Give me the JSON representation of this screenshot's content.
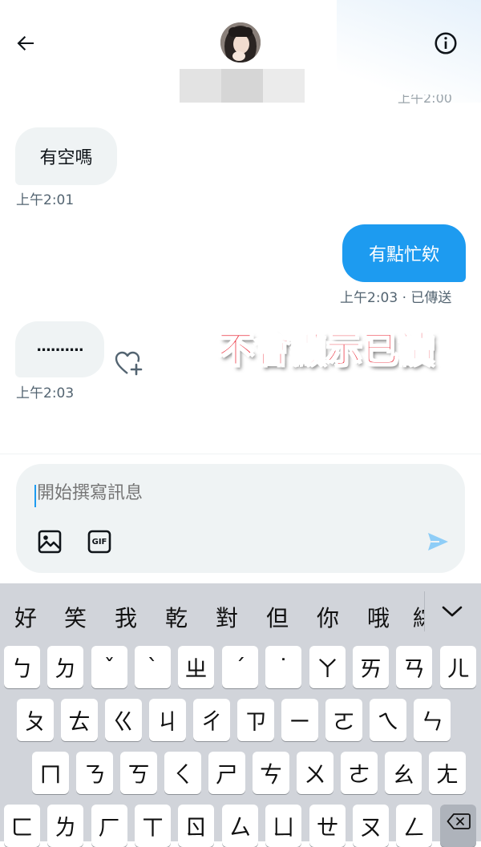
{
  "header": {
    "back_icon": "arrow-left-icon",
    "info_icon": "info-circle-icon",
    "cut_off_timestamp": "上午2:00"
  },
  "messages": [
    {
      "direction": "in",
      "text": "有空嗎",
      "timestamp": "上午2:01"
    },
    {
      "direction": "out",
      "text": "有點忙欸",
      "timestamp": "上午2:03 · 已傳送"
    },
    {
      "direction": "in",
      "text": "..........",
      "timestamp": "上午2:03"
    }
  ],
  "annotation": "不會顯示已讀",
  "composer": {
    "placeholder": "開始撰寫訊息",
    "image_icon": "image-icon",
    "gif_icon": "gif-icon",
    "gif_label": "GIF",
    "send_icon": "send-icon"
  },
  "keyboard": {
    "candidates": [
      "好",
      "笑",
      "我",
      "乾",
      "對",
      "但",
      "你",
      "哦",
      "綜"
    ],
    "row1": [
      "ㄅ",
      "ㄉ",
      "ˇ",
      "ˋ",
      "ㄓ",
      "ˊ",
      "˙",
      "ㄚ",
      "ㄞ",
      "ㄢ",
      "ㄦ"
    ],
    "row2": [
      "ㄆ",
      "ㄊ",
      "ㄍ",
      "ㄐ",
      "ㄔ",
      "ㄗ",
      "ㄧ",
      "ㄛ",
      "ㄟ",
      "ㄣ"
    ],
    "row3": [
      "ㄇ",
      "ㄋ",
      "ㄎ",
      "ㄑ",
      "ㄕ",
      "ㄘ",
      "ㄨ",
      "ㄜ",
      "ㄠ",
      "ㄤ"
    ],
    "row4": [
      "ㄈ",
      "ㄌ",
      "ㄏ",
      "ㄒ",
      "ㄖ",
      "ㄙ",
      "ㄩ",
      "ㄝ",
      "ㄡ",
      "ㄥ"
    ],
    "delete_icon": "backspace-icon",
    "collapse_icon": "chevron-down-icon"
  },
  "colors": {
    "accent": "#1d9bf0",
    "incoming_bubble": "#eff3f4",
    "annotation": "#e60012",
    "keyboard_bg": "#d1d4da"
  }
}
